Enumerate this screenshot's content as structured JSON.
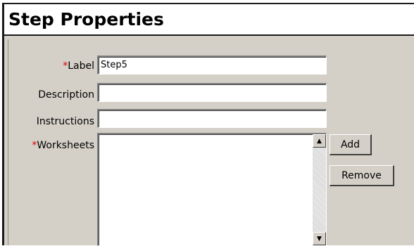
{
  "panel": {
    "title": "Step Properties"
  },
  "fields": {
    "label": {
      "required_mark": "*",
      "label": "Label",
      "value": "Step5"
    },
    "description": {
      "label": "Description",
      "value": ""
    },
    "instructions": {
      "label": "Instructions",
      "value": ""
    },
    "worksheets": {
      "required_mark": "*",
      "label": "Worksheets",
      "items": []
    }
  },
  "buttons": {
    "add": "Add",
    "remove": "Remove"
  },
  "scroll": {
    "up_icon": "▲",
    "down_icon": "▼"
  },
  "colors": {
    "required": "#e00000",
    "panel_bg": "#d4d0c8"
  }
}
